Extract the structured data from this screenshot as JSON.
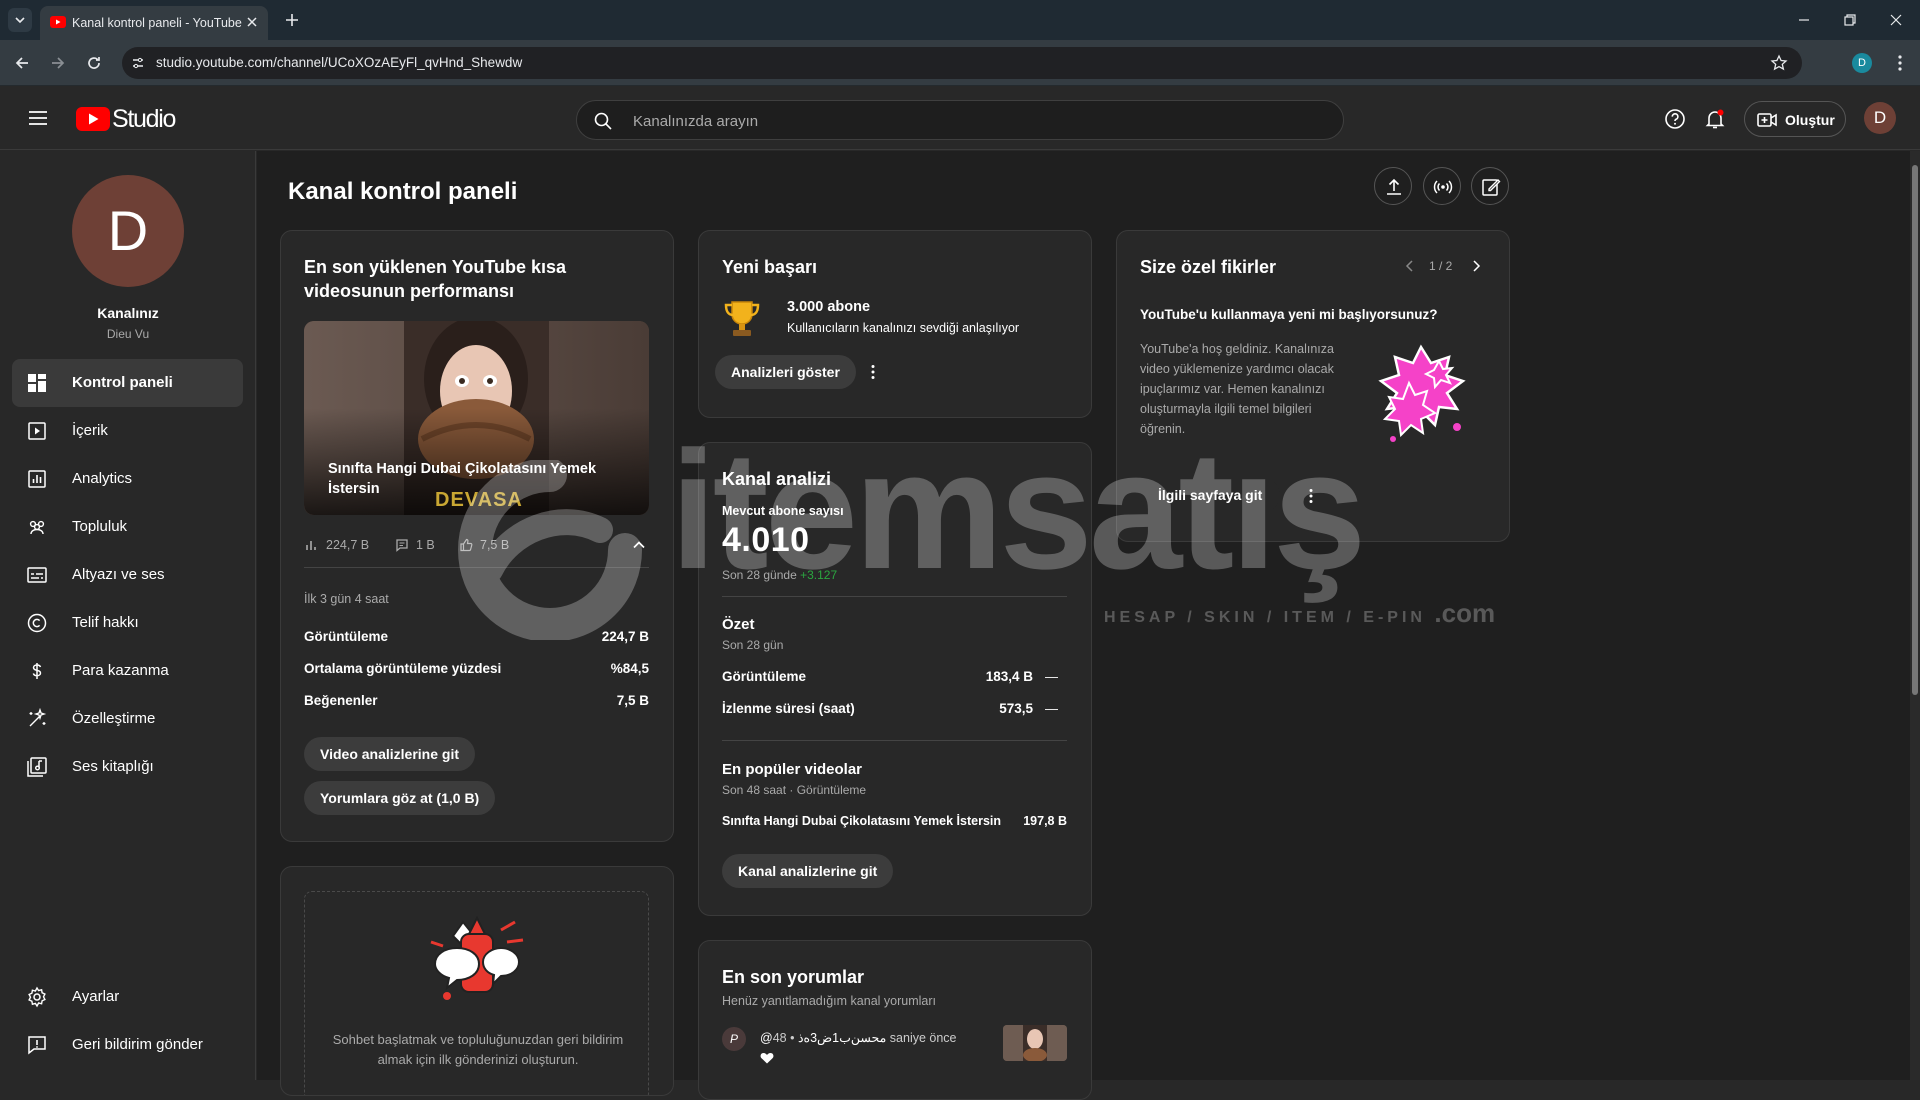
{
  "browser": {
    "tab_title": "Kanal kontrol paneli - YouTube",
    "url": "studio.youtube.com/channel/UCoXOzAEyFl_qvHnd_Shewdw",
    "profile_letter": "D"
  },
  "header": {
    "logo_text": "Studio",
    "search_placeholder": "Kanalınızda arayın",
    "create_label": "Oluştur",
    "avatar_letter": "D"
  },
  "sidebar": {
    "avatar_letter": "D",
    "channel_name": "Kanalınız",
    "channel_handle": "Dieu Vu",
    "items": [
      {
        "label": "Kontrol paneli",
        "icon": "dashboard-icon",
        "active": true
      },
      {
        "label": "İçerik",
        "icon": "content-icon"
      },
      {
        "label": "Analytics",
        "icon": "analytics-icon"
      },
      {
        "label": "Topluluk",
        "icon": "community-icon"
      },
      {
        "label": "Altyazı ve ses",
        "icon": "subtitles-icon"
      },
      {
        "label": "Telif hakkı",
        "icon": "copyright-icon"
      },
      {
        "label": "Para kazanma",
        "icon": "dollar-icon"
      },
      {
        "label": "Özelleştirme",
        "icon": "customization-icon"
      },
      {
        "label": "Ses kitaplığı",
        "icon": "audio-library-icon"
      }
    ],
    "bottom_items": [
      {
        "label": "Ayarlar",
        "icon": "settings-icon"
      },
      {
        "label": "Geri bildirim gönder",
        "icon": "feedback-icon"
      }
    ]
  },
  "main": {
    "title": "Kanal kontrol paneli",
    "short_perf": {
      "title": "En son yüklenen YouTube kısa videosunun performansı",
      "video_title": "Sınıfta Hangi Dubai Çikolatasını Yemek İstersin",
      "thumb_overlay_text": "DEVASA",
      "stat_views": "224,7 B",
      "stat_comments": "1 B",
      "stat_likes": "7,5 B",
      "period": "İlk 3 gün 4 saat",
      "rows": [
        {
          "label": "Görüntüleme",
          "value": "224,7 B"
        },
        {
          "label": "Ortalama görüntüleme yüzdesi",
          "value": "%84,5"
        },
        {
          "label": "Beğenenler",
          "value": "7,5 B"
        }
      ],
      "btn_analytics": "Video analizlerine git",
      "btn_comments": "Yorumlara göz at (1,0 B)"
    },
    "community_card": {
      "text": "Sohbet başlatmak ve topluluğunuzdan geri bildirim almak için ilk gönderinizi oluşturun."
    },
    "achievement": {
      "title": "Yeni başarı",
      "headline": "3.000 abone",
      "desc": "Kullanıcıların kanalınızı sevdiği anlaşılıyor",
      "btn": "Analizleri göster"
    },
    "channel_analytics": {
      "title": "Kanal analizi",
      "subs_label": "Mevcut abone sayısı",
      "subs_value": "4.010",
      "subs_change_prefix": "Son 28 günde",
      "subs_change": "+3.127",
      "summary_title": "Özet",
      "summary_period": "Son 28 gün",
      "summary_rows": [
        {
          "label": "Görüntüleme",
          "value": "183,4 B",
          "trend": "—"
        },
        {
          "label": "İzlenme süresi (saat)",
          "value": "573,5",
          "trend": "—"
        }
      ],
      "top_title": "En popüler videolar",
      "top_period": "Son 48 saat · Görüntüleme",
      "top_rows": [
        {
          "label": "Sınıfta Hangi Dubai Çikolatasını Yemek İstersin",
          "value": "197,8 B"
        }
      ],
      "btn": "Kanal analizlerine git"
    },
    "comments": {
      "title": "En son yorumlar",
      "subtitle": "Henüz yanıtlamadığım kanal yorumları",
      "author": "@محسن‌ب1ض3ه‌ذ",
      "author_letter": "P",
      "time": "• 48 saniye önce"
    },
    "ideas": {
      "title": "Size özel fikirler",
      "pager": "1 / 2",
      "headline": "YouTube'u kullanmaya yeni mi başlıyorsunuz?",
      "body": "YouTube'a hoş geldiniz. Kanalınıza video yüklemenize yardımcı olacak ipuçlarımız var. Hemen kanalınızı oluşturmayla ilgili temel bilgileri öğrenin.",
      "btn": "İlgili sayfaya git"
    }
  },
  "watermark": {
    "brand": "itemsatış",
    "tagline": "HESAP / SKIN / ITEM / E-PIN",
    "suffix": ".com"
  },
  "colors": {
    "youtube_red": "#ff0000",
    "accent_green": "#2ba640",
    "idea_pink": "#f542c8"
  }
}
